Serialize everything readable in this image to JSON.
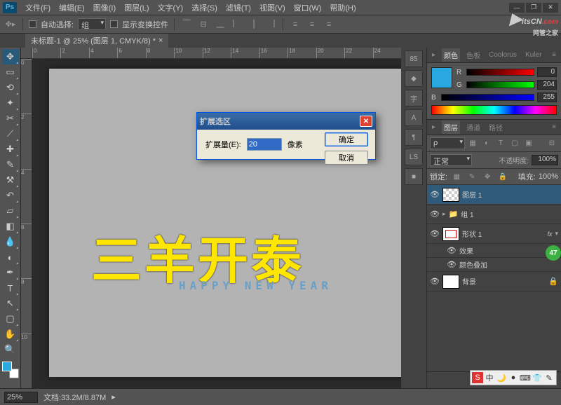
{
  "menu": [
    "文件(F)",
    "编辑(E)",
    "图像(I)",
    "图层(L)",
    "文字(Y)",
    "选择(S)",
    "滤镜(T)",
    "视图(V)",
    "窗口(W)",
    "帮助(H)"
  ],
  "options": {
    "auto_select": "自动选择:",
    "group": "组",
    "show_transform": "显示变换控件"
  },
  "doc_tab": "未标题-1 @ 25% (图层 1, CMYK/8) *",
  "ruler_h": [
    "0",
    "2",
    "4",
    "6",
    "8",
    "10",
    "12",
    "14",
    "16",
    "18",
    "20",
    "22",
    "24"
  ],
  "ruler_v": [
    "0",
    "2",
    "4",
    "6",
    "8",
    "10"
  ],
  "artwork": {
    "main": "三羊开泰",
    "sub": "HAPPY NEW YEAR"
  },
  "color_panel": {
    "tabs": [
      "颜色",
      "色板",
      "Coolorus",
      "Kuler"
    ],
    "channels": [
      {
        "l": "R",
        "v": "0"
      },
      {
        "l": "G",
        "v": "204"
      },
      {
        "l": "B",
        "v": "255"
      }
    ]
  },
  "layers_panel": {
    "tabs": [
      "图层",
      "通道",
      "路径"
    ],
    "blend": "正常",
    "opacity_label": "不透明度:",
    "opacity": "100%",
    "lock_label": "锁定:",
    "fill_label": "填充:",
    "fill": "100%",
    "items": [
      {
        "name": "图层 1",
        "active": true,
        "thumb": "check"
      },
      {
        "name": "组 1",
        "type": "group"
      },
      {
        "name": "形状 1",
        "thumb": "shape",
        "fx": "fx"
      },
      {
        "name": "效果",
        "sub": true
      },
      {
        "name": "颜色叠加",
        "sub": true
      },
      {
        "name": "背景",
        "thumb": "bg",
        "lock": true
      }
    ]
  },
  "dialog": {
    "title": "扩展选区",
    "field_label": "扩展量(E):",
    "value": "20",
    "unit": "像素",
    "ok": "确定",
    "cancel": "取消"
  },
  "status": {
    "zoom": "25%",
    "info": "文档:33.2M/8.87M"
  },
  "badge": "47",
  "watermark": {
    "a": "itsCN",
    "b": ".com",
    "c": "网管之家"
  },
  "dock": [
    "85",
    "◆",
    "字",
    "A",
    "¶",
    "LS",
    "■"
  ]
}
